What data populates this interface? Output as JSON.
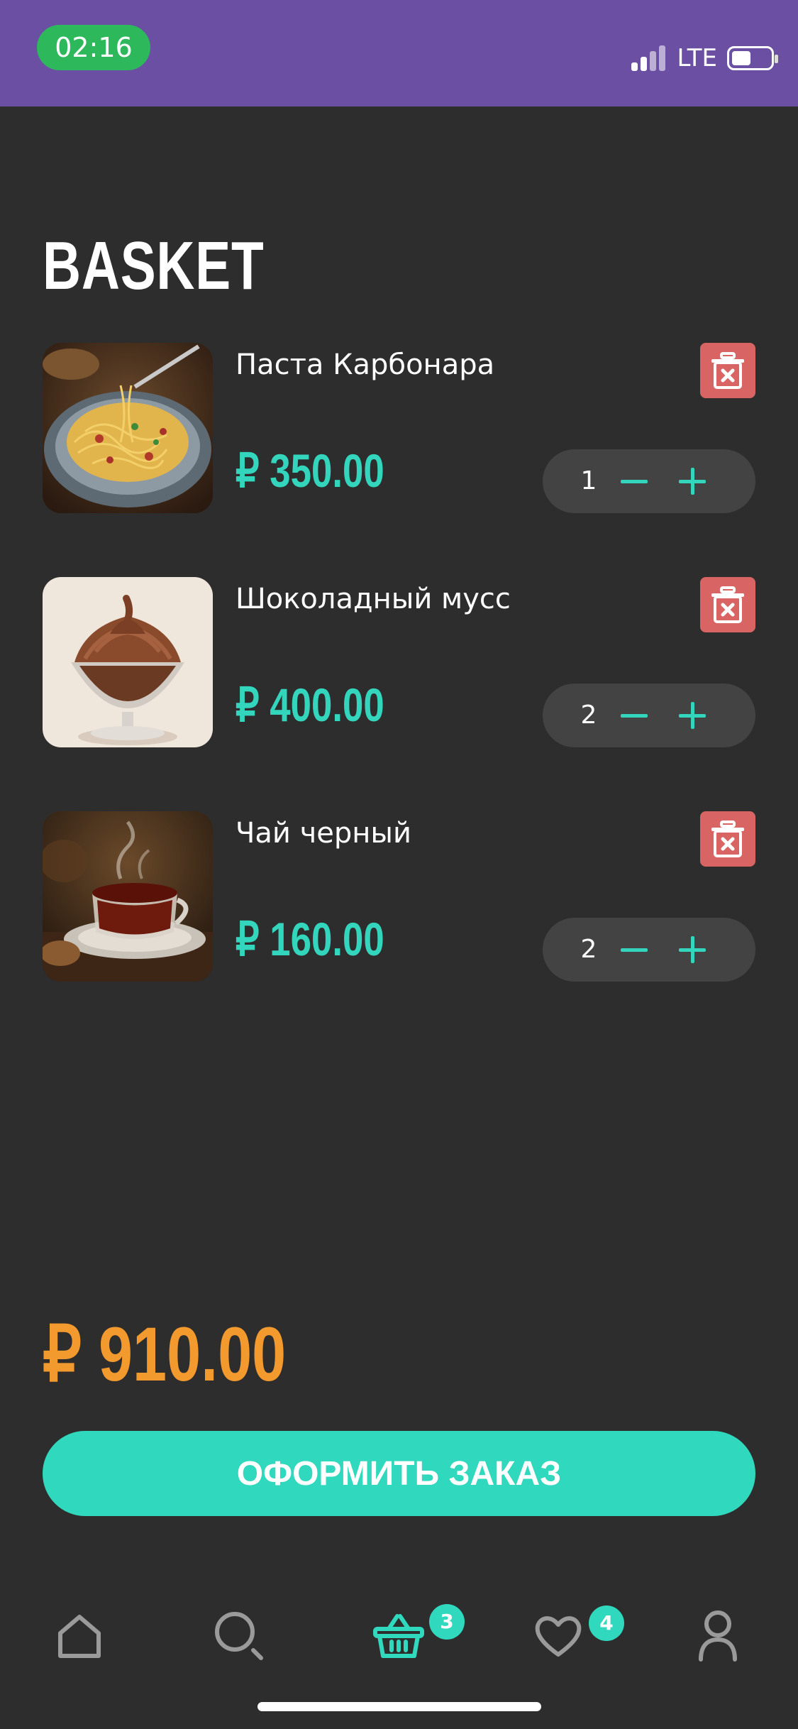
{
  "status_bar": {
    "time": "02:16",
    "network": "LTE",
    "icons": [
      "signal-icon",
      "battery-icon"
    ]
  },
  "page": {
    "title": "BASKET"
  },
  "items": [
    {
      "name": "Паста Карбонара",
      "price": "₽ 350.00",
      "quantity": "1",
      "image": "pasta-image"
    },
    {
      "name": "Шоколадный мусс",
      "price": "₽ 400.00",
      "quantity": "2",
      "image": "mousse-image"
    },
    {
      "name": "Чай черный",
      "price": "₽ 160.00",
      "quantity": "2",
      "image": "tea-image"
    }
  ],
  "total": "₽ 910.00",
  "checkout": {
    "label": "ОФОРМИТЬ ЗАКАЗ"
  },
  "nav": {
    "items": [
      "home-icon",
      "search-icon",
      "basket-icon",
      "heart-icon",
      "profile-icon"
    ],
    "basket_badge": "3",
    "favorites_badge": "4"
  },
  "colors": {
    "accent": "#30d9bd",
    "total": "#f29a2e",
    "delete": "#d96464",
    "status_bar": "#6a4fa3",
    "background": "#2d2d2d"
  }
}
